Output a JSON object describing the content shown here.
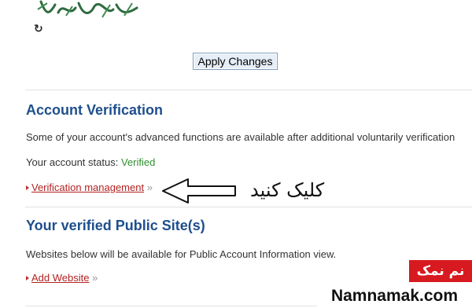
{
  "form": {
    "refresh_icon": "refresh-icon",
    "apply_label": "Apply Changes"
  },
  "verification": {
    "title": "Account Verification",
    "description": "Some of your account's advanced functions are available after additional voluntarily verification",
    "status_label": "Your account status:",
    "status_value": "Verified",
    "manage_link": "Verification management",
    "raquo": "»"
  },
  "annotation": {
    "text": "کلیک کنید",
    "arrow_icon": "left-arrow-icon"
  },
  "public_sites": {
    "title": "Your verified Public Site(s)",
    "description": "Websites below will be available for Public Account Information view.",
    "add_link": "Add Website",
    "raquo": "»"
  },
  "watermark": {
    "fa_text": "نم نمک",
    "en_text": "Namnamak.com"
  },
  "colors": {
    "heading": "#1e4f8c",
    "verified": "#2f8f2f",
    "link": "#b22222",
    "brand_red": "#d71920"
  }
}
